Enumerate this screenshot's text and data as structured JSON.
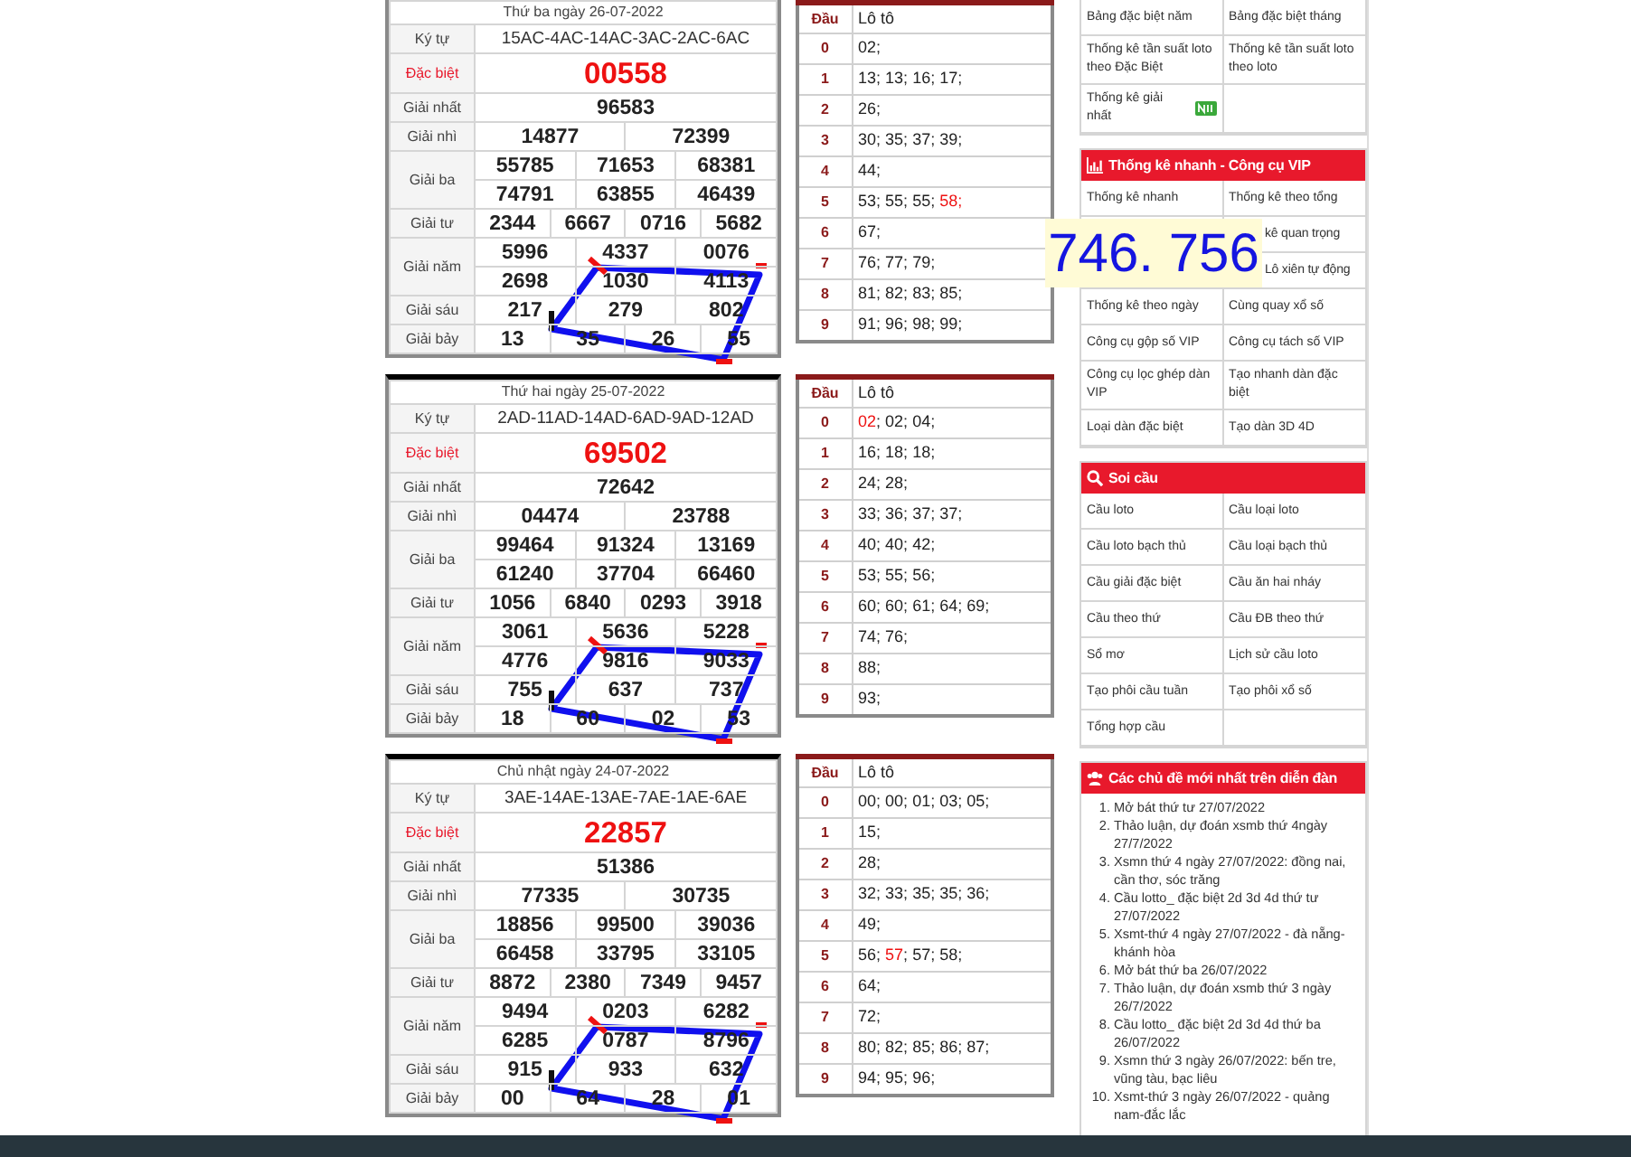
{
  "draws": [
    {
      "date": "Thứ ba ngày 26-07-2022",
      "prizes": [
        {
          "name": "Ký tự",
          "kind": "code",
          "rows": [
            [
              "15AC-4AC-14AC-3AC-2AC-6AC"
            ]
          ]
        },
        {
          "name": "Đặc biệt",
          "kind": "special",
          "rows": [
            [
              "00558"
            ]
          ]
        },
        {
          "name": "Giải nhất",
          "kind": "normal",
          "rows": [
            [
              "96583"
            ]
          ]
        },
        {
          "name": "Giải nhì",
          "kind": "normal",
          "rows": [
            [
              "14877",
              "72399"
            ]
          ]
        },
        {
          "name": "Giải ba",
          "kind": "normal",
          "rows": [
            [
              "55785",
              "71653",
              "68381"
            ],
            [
              "74791",
              "63855",
              "46439"
            ]
          ]
        },
        {
          "name": "Giải tư",
          "kind": "normal",
          "rows": [
            [
              "2344",
              "6667",
              "0716",
              "5682"
            ]
          ]
        },
        {
          "name": "Giải năm",
          "kind": "normal",
          "rows": [
            [
              "5996",
              "4337",
              "0076"
            ],
            [
              "2698",
              "1030",
              "4113"
            ]
          ]
        },
        {
          "name": "Giải sáu",
          "kind": "normal",
          "rows": [
            [
              "217",
              "279",
              "802"
            ]
          ]
        },
        {
          "name": "Giải bảy",
          "kind": "normal",
          "rows": [
            [
              "13",
              "35",
              "26",
              "55"
            ]
          ]
        }
      ],
      "loto": {
        "columns": [
          "Đầu",
          "Lô tô"
        ],
        "rows": [
          {
            "head": "0",
            "numbers": [
              {
                "v": "02;",
                "hot": false
              }
            ]
          },
          {
            "head": "1",
            "numbers": [
              {
                "v": "13;",
                "hot": false
              },
              {
                "v": "13;",
                "hot": false
              },
              {
                "v": "16;",
                "hot": false
              },
              {
                "v": "17;",
                "hot": false
              }
            ]
          },
          {
            "head": "2",
            "numbers": [
              {
                "v": "26;",
                "hot": false
              }
            ]
          },
          {
            "head": "3",
            "numbers": [
              {
                "v": "30;",
                "hot": false
              },
              {
                "v": "35;",
                "hot": false
              },
              {
                "v": "37;",
                "hot": false
              },
              {
                "v": "39;",
                "hot": false
              }
            ]
          },
          {
            "head": "4",
            "numbers": [
              {
                "v": "44;",
                "hot": false
              }
            ]
          },
          {
            "head": "5",
            "numbers": [
              {
                "v": "53;",
                "hot": false
              },
              {
                "v": "55;",
                "hot": false
              },
              {
                "v": "55;",
                "hot": false
              },
              {
                "v": "58;",
                "hot": true
              }
            ]
          },
          {
            "head": "6",
            "numbers": [
              {
                "v": "67;",
                "hot": false
              }
            ]
          },
          {
            "head": "7",
            "numbers": [
              {
                "v": "76;",
                "hot": false
              },
              {
                "v": "77;",
                "hot": false
              },
              {
                "v": "79;",
                "hot": false
              }
            ]
          },
          {
            "head": "8",
            "numbers": [
              {
                "v": "81;",
                "hot": false
              },
              {
                "v": "82;",
                "hot": false
              },
              {
                "v": "83;",
                "hot": false
              },
              {
                "v": "85;",
                "hot": false
              }
            ]
          },
          {
            "head": "9",
            "numbers": [
              {
                "v": "91;",
                "hot": false
              },
              {
                "v": "96;",
                "hot": false
              },
              {
                "v": "98;",
                "hot": false
              },
              {
                "v": "99;",
                "hot": false
              }
            ]
          }
        ]
      }
    },
    {
      "date": "Thứ hai ngày 25-07-2022",
      "prizes": [
        {
          "name": "Ký tự",
          "kind": "code",
          "rows": [
            [
              "2AD-11AD-14AD-6AD-9AD-12AD"
            ]
          ]
        },
        {
          "name": "Đặc biệt",
          "kind": "special",
          "rows": [
            [
              "69502"
            ]
          ]
        },
        {
          "name": "Giải nhất",
          "kind": "normal",
          "rows": [
            [
              "72642"
            ]
          ]
        },
        {
          "name": "Giải nhì",
          "kind": "normal",
          "rows": [
            [
              "04474",
              "23788"
            ]
          ]
        },
        {
          "name": "Giải ba",
          "kind": "normal",
          "rows": [
            [
              "99464",
              "91324",
              "13169"
            ],
            [
              "61240",
              "37704",
              "66460"
            ]
          ]
        },
        {
          "name": "Giải tư",
          "kind": "normal",
          "rows": [
            [
              "1056",
              "6840",
              "0293",
              "3918"
            ]
          ]
        },
        {
          "name": "Giải năm",
          "kind": "normal",
          "rows": [
            [
              "3061",
              "5636",
              "5228"
            ],
            [
              "4776",
              "9816",
              "9033"
            ]
          ]
        },
        {
          "name": "Giải sáu",
          "kind": "normal",
          "rows": [
            [
              "755",
              "637",
              "737"
            ]
          ]
        },
        {
          "name": "Giải bảy",
          "kind": "normal",
          "rows": [
            [
              "18",
              "60",
              "02",
              "53"
            ]
          ]
        }
      ],
      "loto": {
        "columns": [
          "Đầu",
          "Lô tô"
        ],
        "rows": [
          {
            "head": "0",
            "numbers": [
              {
                "v": "02",
                "hot": true
              },
              {
                "v": ";",
                "hot": false
              },
              {
                "v": "02;",
                "hot": false
              },
              {
                "v": "04;",
                "hot": false
              }
            ]
          },
          {
            "head": "1",
            "numbers": [
              {
                "v": "16;",
                "hot": false
              },
              {
                "v": "18;",
                "hot": false
              },
              {
                "v": "18;",
                "hot": false
              }
            ]
          },
          {
            "head": "2",
            "numbers": [
              {
                "v": "24;",
                "hot": false
              },
              {
                "v": "28;",
                "hot": false
              }
            ]
          },
          {
            "head": "3",
            "numbers": [
              {
                "v": "33;",
                "hot": false
              },
              {
                "v": "36;",
                "hot": false
              },
              {
                "v": "37;",
                "hot": false
              },
              {
                "v": "37;",
                "hot": false
              }
            ]
          },
          {
            "head": "4",
            "numbers": [
              {
                "v": "40;",
                "hot": false
              },
              {
                "v": "40;",
                "hot": false
              },
              {
                "v": "42;",
                "hot": false
              }
            ]
          },
          {
            "head": "5",
            "numbers": [
              {
                "v": "53;",
                "hot": false
              },
              {
                "v": "55;",
                "hot": false
              },
              {
                "v": "56;",
                "hot": false
              }
            ]
          },
          {
            "head": "6",
            "numbers": [
              {
                "v": "60;",
                "hot": false
              },
              {
                "v": "60;",
                "hot": false
              },
              {
                "v": "61;",
                "hot": false
              },
              {
                "v": "64;",
                "hot": false
              },
              {
                "v": "69;",
                "hot": false
              }
            ]
          },
          {
            "head": "7",
            "numbers": [
              {
                "v": "74;",
                "hot": false
              },
              {
                "v": "76;",
                "hot": false
              }
            ]
          },
          {
            "head": "8",
            "numbers": [
              {
                "v": "88;",
                "hot": false
              }
            ]
          },
          {
            "head": "9",
            "numbers": [
              {
                "v": "93;",
                "hot": false
              }
            ]
          }
        ]
      }
    },
    {
      "date": "Chủ nhật ngày 24-07-2022",
      "prizes": [
        {
          "name": "Ký tự",
          "kind": "code",
          "rows": [
            [
              "3AE-14AE-13AE-7AE-1AE-6AE"
            ]
          ]
        },
        {
          "name": "Đặc biệt",
          "kind": "special",
          "rows": [
            [
              "22857"
            ]
          ]
        },
        {
          "name": "Giải nhất",
          "kind": "normal",
          "rows": [
            [
              "51386"
            ]
          ]
        },
        {
          "name": "Giải nhì",
          "kind": "normal",
          "rows": [
            [
              "77335",
              "30735"
            ]
          ]
        },
        {
          "name": "Giải ba",
          "kind": "normal",
          "rows": [
            [
              "18856",
              "99500",
              "39036"
            ],
            [
              "66458",
              "33795",
              "33105"
            ]
          ]
        },
        {
          "name": "Giải tư",
          "kind": "normal",
          "rows": [
            [
              "8872",
              "2380",
              "7349",
              "9457"
            ]
          ]
        },
        {
          "name": "Giải năm",
          "kind": "normal",
          "rows": [
            [
              "9494",
              "0203",
              "6282"
            ],
            [
              "6285",
              "0787",
              "8796"
            ]
          ]
        },
        {
          "name": "Giải sáu",
          "kind": "normal",
          "rows": [
            [
              "915",
              "933",
              "632"
            ]
          ]
        },
        {
          "name": "Giải bảy",
          "kind": "normal",
          "rows": [
            [
              "00",
              "64",
              "28",
              "01"
            ]
          ]
        }
      ],
      "loto": {
        "columns": [
          "Đầu",
          "Lô tô"
        ],
        "rows": [
          {
            "head": "0",
            "numbers": [
              {
                "v": "00;",
                "hot": false
              },
              {
                "v": "00;",
                "hot": false
              },
              {
                "v": "01;",
                "hot": false
              },
              {
                "v": "03;",
                "hot": false
              },
              {
                "v": "05;",
                "hot": false
              }
            ]
          },
          {
            "head": "1",
            "numbers": [
              {
                "v": "15;",
                "hot": false
              }
            ]
          },
          {
            "head": "2",
            "numbers": [
              {
                "v": "28;",
                "hot": false
              }
            ]
          },
          {
            "head": "3",
            "numbers": [
              {
                "v": "32;",
                "hot": false
              },
              {
                "v": "33;",
                "hot": false
              },
              {
                "v": "35;",
                "hot": false
              },
              {
                "v": "35;",
                "hot": false
              },
              {
                "v": "36;",
                "hot": false
              }
            ]
          },
          {
            "head": "4",
            "numbers": [
              {
                "v": "49;",
                "hot": false
              }
            ]
          },
          {
            "head": "5",
            "numbers": [
              {
                "v": "56;",
                "hot": false
              },
              {
                "v": "57",
                "hot": true
              },
              {
                "v": ";",
                "hot": false
              },
              {
                "v": "57;",
                "hot": false
              },
              {
                "v": "58;",
                "hot": false
              }
            ]
          },
          {
            "head": "6",
            "numbers": [
              {
                "v": "64;",
                "hot": false
              }
            ]
          },
          {
            "head": "7",
            "numbers": [
              {
                "v": "72;",
                "hot": false
              }
            ]
          },
          {
            "head": "8",
            "numbers": [
              {
                "v": "80;",
                "hot": false
              },
              {
                "v": "82;",
                "hot": false
              },
              {
                "v": "85;",
                "hot": false
              },
              {
                "v": "86;",
                "hot": false
              },
              {
                "v": "87;",
                "hot": false
              }
            ]
          },
          {
            "head": "9",
            "numbers": [
              {
                "v": "94;",
                "hot": false
              },
              {
                "v": "95;",
                "hot": false
              },
              {
                "v": "96;",
                "hot": false
              }
            ]
          }
        ]
      }
    }
  ],
  "overlay": {
    "text": "746. 756"
  },
  "sidebar": [
    {
      "kind": "links",
      "links": [
        {
          "text": "Bảng đặc biệt năm",
          "new": false
        },
        {
          "text": "Bảng đặc biệt tháng",
          "new": false
        },
        {
          "text": "Thống kê tần suất loto theo Đặc Biệt",
          "new": false
        },
        {
          "text": "Thống kê tần suất loto theo loto",
          "new": false
        },
        {
          "text": "Thống kê giải nhất",
          "new": true
        }
      ]
    },
    {
      "kind": "links",
      "title": "Thống kê nhanh - Công cụ VIP",
      "links": [
        {
          "text": "Thống kê nhanh",
          "new": false
        },
        {
          "text": "Thống kê theo tổng",
          "new": false
        },
        {
          "text": "kê quan trọng",
          "covered": true,
          "new": false
        },
        {
          "text": "Lô xiên tự động",
          "covered": true,
          "new": false
        },
        {
          "text": "Thống kê theo ngày",
          "new": false
        },
        {
          "text": "Cùng quay xổ số",
          "new": false
        },
        {
          "text": "Công cụ gộp số VIP",
          "new": false
        },
        {
          "text": "Công cụ tách số VIP",
          "new": false
        },
        {
          "text": "Công cụ lọc ghép dàn VIP",
          "new": false
        },
        {
          "text": "Tạo nhanh dàn đặc biệt",
          "new": false
        },
        {
          "text": "Loại dàn đặc biệt",
          "new": false
        },
        {
          "text": "Tạo dàn 3D 4D",
          "new": false
        }
      ]
    },
    {
      "kind": "links",
      "title": "Soi cầu",
      "links": [
        {
          "text": "Cầu loto",
          "new": false
        },
        {
          "text": "Cầu loại loto",
          "new": false
        },
        {
          "text": "Cầu loto bạch thủ",
          "new": false
        },
        {
          "text": "Cầu loại bạch thủ",
          "new": false
        },
        {
          "text": "Cầu giải đặc biệt",
          "new": false
        },
        {
          "text": "Cầu ăn hai nháy",
          "new": false
        },
        {
          "text": "Cầu theo thứ",
          "new": false
        },
        {
          "text": "Cầu ĐB theo thứ",
          "new": false
        },
        {
          "text": "Sổ mơ",
          "new": false
        },
        {
          "text": "Lịch sử cầu loto",
          "new": false
        },
        {
          "text": "Tạo phôi cầu tuần",
          "new": false
        },
        {
          "text": "Tạo phôi xổ số",
          "new": false
        },
        {
          "text": "Tổng hợp cầu",
          "new": false
        }
      ]
    },
    {
      "kind": "topics",
      "title": "Các chủ đề mới nhất trên diễn đàn",
      "topics": [
        {
          "number": "1.",
          "text": "Mở bát thứ tư 27/07/2022"
        },
        {
          "number": "2.",
          "text": "Thảo luận, dự đoán xsmb thứ 4ngày 27/7/2022"
        },
        {
          "number": "3.",
          "text": "Xsmn thứ 4 ngày 27/07/2022: đồng nai, cần thơ, sóc trăng"
        },
        {
          "number": "4.",
          "text": "Cầu lotto_ đặc biệt 2d 3d 4d thứ tư 27/07/2022"
        },
        {
          "number": "5.",
          "text": "Xsmt-thứ 4 ngày 27/07/2022 - đà nẵng-khánh hòa"
        },
        {
          "number": "6.",
          "text": "Mở bát thứ ba 26/07/2022"
        },
        {
          "number": "7.",
          "text": "Thảo luận, dự đoán xsmb thứ 3 ngày 26/7/2022"
        },
        {
          "number": "8.",
          "text": "Cầu lotto_ đặc biệt 2d 3d 4d thứ ba 26/07/2022"
        },
        {
          "number": "9.",
          "text": "Xsmn thứ 3 ngày 26/07/2022: bến tre, vũng tàu, bạc liêu"
        },
        {
          "number": "10.",
          "text": "Xsmt-thứ 3 ngày 26/07/2022 - quảng nam-đắc lắc"
        }
      ]
    }
  ]
}
